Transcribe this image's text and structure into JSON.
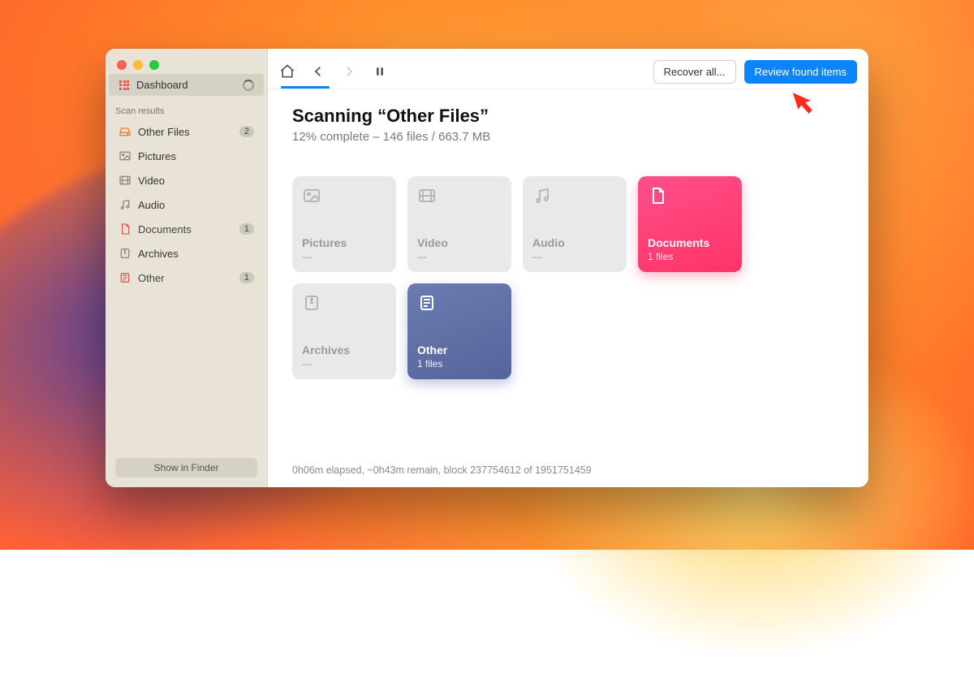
{
  "sidebar": {
    "dashboard_label": "Dashboard",
    "section_label": "Scan results",
    "items": [
      {
        "icon": "drive",
        "label": "Other Files",
        "badge": "2"
      },
      {
        "icon": "picture",
        "label": "Pictures",
        "badge": ""
      },
      {
        "icon": "video",
        "label": "Video",
        "badge": ""
      },
      {
        "icon": "audio",
        "label": "Audio",
        "badge": ""
      },
      {
        "icon": "document",
        "label": "Documents",
        "badge": "1"
      },
      {
        "icon": "archive",
        "label": "Archives",
        "badge": ""
      },
      {
        "icon": "other",
        "label": "Other",
        "badge": "1"
      }
    ],
    "show_in_finder": "Show in Finder"
  },
  "toolbar": {
    "recover_all": "Recover all...",
    "review_found": "Review found items"
  },
  "scan": {
    "title": "Scanning “Other Files”",
    "subtitle": "12% complete – 146 files / 663.7 MB",
    "footer": "0h06m elapsed, ~0h43m remain, block 237754612 of 1951751459"
  },
  "cards": {
    "pictures": {
      "title": "Pictures",
      "sub": "—"
    },
    "video": {
      "title": "Video",
      "sub": "—"
    },
    "audio": {
      "title": "Audio",
      "sub": "—"
    },
    "documents": {
      "title": "Documents",
      "sub": "1 files"
    },
    "archives": {
      "title": "Archives",
      "sub": "—"
    },
    "other": {
      "title": "Other",
      "sub": "1 files"
    }
  }
}
